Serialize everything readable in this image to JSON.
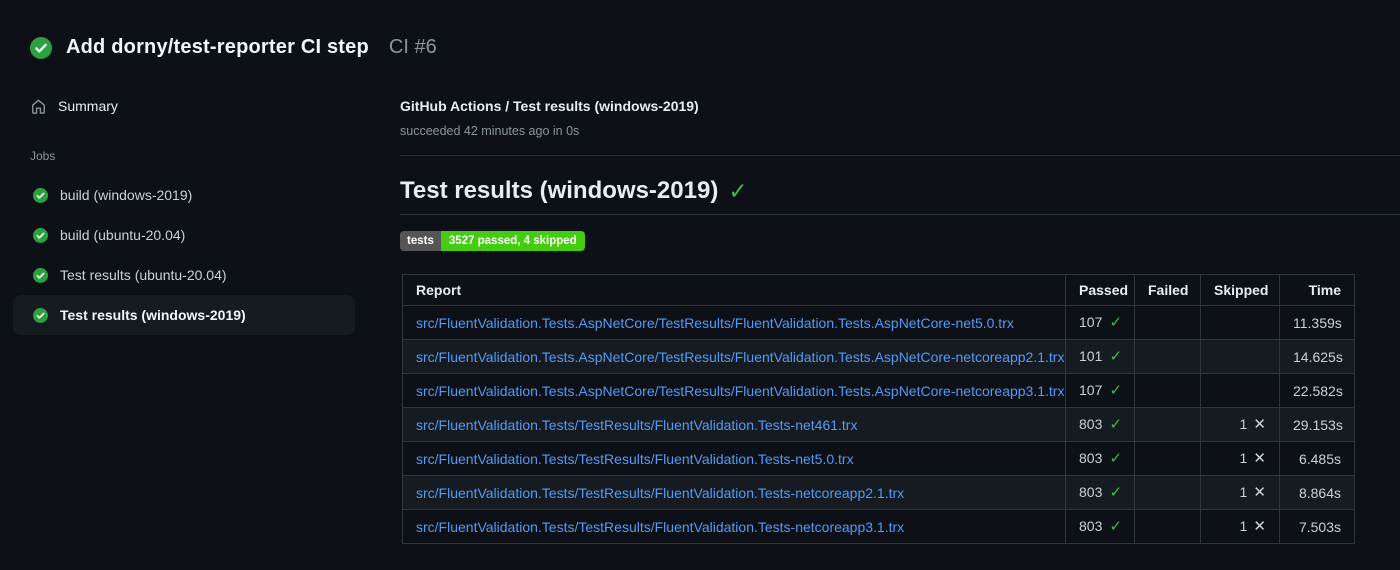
{
  "header": {
    "title": "Add dorny/test-reporter CI step",
    "run_number": "CI #6",
    "status": "success"
  },
  "sidebar": {
    "summary_label": "Summary",
    "jobs_heading": "Jobs",
    "jobs": [
      {
        "label": "build (windows-2019)",
        "status": "success",
        "selected": false
      },
      {
        "label": "build (ubuntu-20.04)",
        "status": "success",
        "selected": false
      },
      {
        "label": "Test results (ubuntu-20.04)",
        "status": "success",
        "selected": false
      },
      {
        "label": "Test results (windows-2019)",
        "status": "success",
        "selected": true
      }
    ]
  },
  "main": {
    "breadcrumb": "GitHub Actions / Test results (windows-2019)",
    "status_line": "succeeded 42 minutes ago in 0s",
    "section_title": "Test results (windows-2019)",
    "section_status_icon": "check",
    "badge": {
      "label": "tests",
      "value": "3527 passed, 4 skipped",
      "label_bg": "#555555",
      "value_bg": "#44cc11"
    },
    "table": {
      "columns": [
        "Report",
        "Passed",
        "Failed",
        "Skipped",
        "Time"
      ],
      "rows": [
        {
          "report": "src/FluentValidation.Tests.AspNetCore/TestResults/FluentValidation.Tests.AspNetCore-net5.0.trx",
          "passed": "107",
          "failed": "",
          "skipped": "",
          "time": "11.359s"
        },
        {
          "report": "src/FluentValidation.Tests.AspNetCore/TestResults/FluentValidation.Tests.AspNetCore-netcoreapp2.1.trx",
          "passed": "101",
          "failed": "",
          "skipped": "",
          "time": "14.625s"
        },
        {
          "report": "src/FluentValidation.Tests.AspNetCore/TestResults/FluentValidation.Tests.AspNetCore-netcoreapp3.1.trx",
          "passed": "107",
          "failed": "",
          "skipped": "",
          "time": "22.582s"
        },
        {
          "report": "src/FluentValidation.Tests/TestResults/FluentValidation.Tests-net461.trx",
          "passed": "803",
          "failed": "",
          "skipped": "1",
          "time": "29.153s"
        },
        {
          "report": "src/FluentValidation.Tests/TestResults/FluentValidation.Tests-net5.0.trx",
          "passed": "803",
          "failed": "",
          "skipped": "1",
          "time": "6.485s"
        },
        {
          "report": "src/FluentValidation.Tests/TestResults/FluentValidation.Tests-netcoreapp2.1.trx",
          "passed": "803",
          "failed": "",
          "skipped": "1",
          "time": "8.864s"
        },
        {
          "report": "src/FluentValidation.Tests/TestResults/FluentValidation.Tests-netcoreapp3.1.trx",
          "passed": "803",
          "failed": "",
          "skipped": "1",
          "time": "7.503s"
        }
      ]
    }
  },
  "icons": {
    "run_status": "check-circle-icon",
    "summary": "home-icon",
    "job_status": "check-circle-icon",
    "passed_mark": "✓",
    "skipped_mark": "✕"
  },
  "colors": {
    "background": "#0d1117",
    "success_green": "#2ea043",
    "check_green": "#3fb950",
    "link_blue": "#539bf5",
    "row_stripe": "#161b22",
    "table_border": "#30363d",
    "muted_text": "#8b949e"
  }
}
